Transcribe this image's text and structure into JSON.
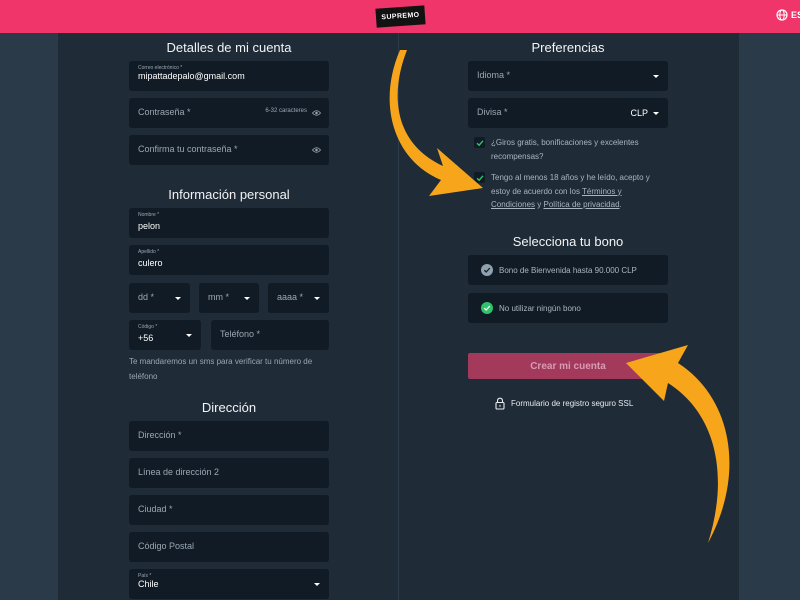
{
  "header": {
    "logo": "SUPREMO",
    "language": "ES",
    "colors": {
      "bar": "#f0356a",
      "panel": "#1f2b37",
      "field": "#101b25",
      "accent_green": "#2fc46b",
      "arrow": "#f7a61c"
    }
  },
  "account": {
    "title": "Detalles de mi cuenta",
    "email_label": "Correo electrónico *",
    "email_value": "mipattadepalo@gmail.com",
    "password_placeholder": "Contraseña *",
    "password_hint": "6-32 caracteres",
    "confirm_placeholder": "Confirma tu contraseña *"
  },
  "personal": {
    "title": "Información personal",
    "first_name_label": "Nombre *",
    "first_name_value": "pelon",
    "last_name_label": "Apellido *",
    "last_name_value": "culero",
    "day_placeholder": "dd *",
    "month_placeholder": "mm *",
    "year_placeholder": "aaaa *",
    "code_label": "Código *",
    "code_value": "+56",
    "phone_placeholder": "Teléfono *",
    "sms_notice": "Te mandaremos un sms para verificar tu número de teléfono"
  },
  "address": {
    "title": "Dirección",
    "address_placeholder": "Dirección *",
    "line2_placeholder": "Línea de dirección 2",
    "city_placeholder": "Ciudad *",
    "postal_placeholder": "Código Postal",
    "country_label": "País *",
    "country_value": "Chile"
  },
  "preferences": {
    "title": "Preferencias",
    "language_placeholder": "Idioma *",
    "currency_placeholder": "Divisa *",
    "currency_value": "CLP",
    "promo_text": "¿Giros gratis, bonificaciones y excelentes recompensas?",
    "terms_prefix": "Tengo al menos 18 años y he leído, acepto y estoy de acuerdo con los ",
    "terms_link": "Términos y Condiciones",
    "terms_mid": " y ",
    "privacy_link": "Política de privacidad",
    "terms_suffix": "."
  },
  "bonus": {
    "title": "Selecciona tu bono",
    "welcome_bonus": "Bono de Bienvenida hasta 90.000 CLP",
    "no_bonus": "No utilizar ningún bono"
  },
  "actions": {
    "create_account": "Crear mi cuenta",
    "ssl_text": "Formulario de registro seguro SSL"
  }
}
